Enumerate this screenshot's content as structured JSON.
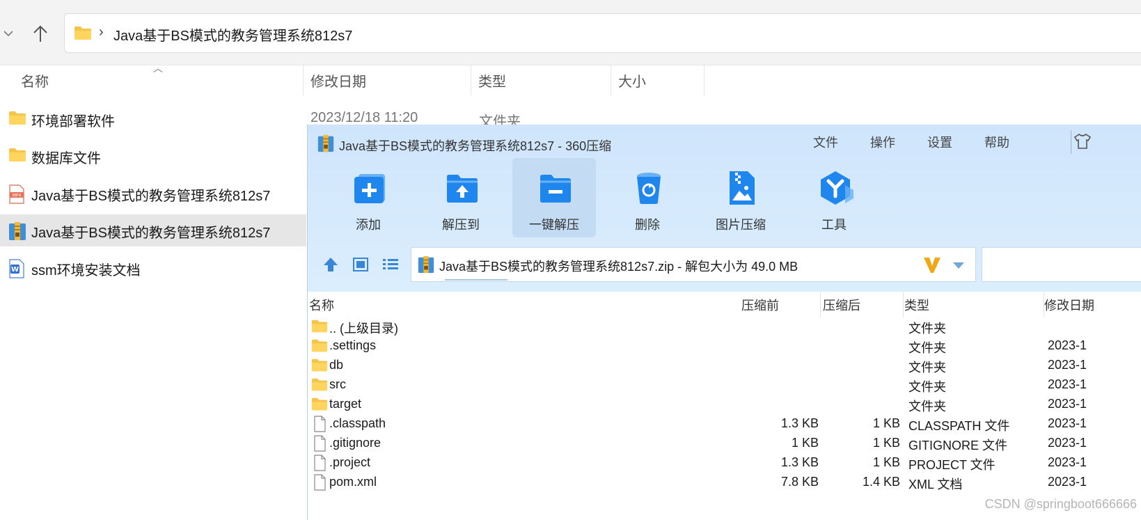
{
  "explorer": {
    "address": {
      "separator": "›",
      "path": "Java基于BS模式的教务管理系统812s7"
    },
    "columns": {
      "name": "名称",
      "date": "修改日期",
      "type": "类型",
      "size": "大小"
    },
    "rows": [
      {
        "name": "环境部署软件",
        "date": "2023/12/18 11:20",
        "type": "文件夹",
        "icon": "folder-icon"
      },
      {
        "name": "数据库文件",
        "icon": "folder-icon"
      },
      {
        "name": "Java基于BS模式的教务管理系统812s7",
        "icon": "mp4-file-icon"
      },
      {
        "name": "Java基于BS模式的教务管理系统812s7",
        "icon": "zip-archive-icon",
        "selected": true
      },
      {
        "name": "ssm环境安装文档",
        "icon": "word-doc-icon"
      }
    ]
  },
  "zip": {
    "title": "Java基于BS模式的教务管理系统812s7 - 360压缩",
    "menu": [
      "文件",
      "操作",
      "设置",
      "帮助"
    ],
    "toolbar": [
      {
        "label": "添加",
        "icon": "add-icon"
      },
      {
        "label": "解压到",
        "icon": "extract-to-icon"
      },
      {
        "label": "一键解压",
        "icon": "one-click-extract-icon",
        "active": true
      },
      {
        "label": "删除",
        "icon": "delete-icon"
      },
      {
        "label": "图片压缩",
        "icon": "image-compress-icon"
      },
      {
        "label": "工具",
        "icon": "tools-icon"
      }
    ],
    "path_text": "Java基于BS模式的教务管理系统812s7.zip - 解包大小为 49.0 MB",
    "list_columns": {
      "name": "名称",
      "before": "压缩前",
      "after": "压缩后",
      "type": "类型",
      "date": "修改日期"
    },
    "files": [
      {
        "name": ".. (上级目录)",
        "before": "",
        "after": "",
        "type": "文件夹",
        "date": "",
        "icon": "folder"
      },
      {
        "name": ".settings",
        "before": "",
        "after": "",
        "type": "文件夹",
        "date": "2023-1",
        "icon": "folder"
      },
      {
        "name": "db",
        "before": "",
        "after": "",
        "type": "文件夹",
        "date": "2023-1",
        "icon": "folder"
      },
      {
        "name": "src",
        "before": "",
        "after": "",
        "type": "文件夹",
        "date": "2023-1",
        "icon": "folder"
      },
      {
        "name": "target",
        "before": "",
        "after": "",
        "type": "文件夹",
        "date": "2023-1",
        "icon": "folder"
      },
      {
        "name": ".classpath",
        "before": "1.3 KB",
        "after": "1 KB",
        "type": "CLASSPATH 文件",
        "date": "2023-1",
        "icon": "file"
      },
      {
        "name": ".gitignore",
        "before": "1 KB",
        "after": "1 KB",
        "type": "GITIGNORE 文件",
        "date": "2023-1",
        "icon": "file"
      },
      {
        "name": ".project",
        "before": "1.3 KB",
        "after": "1 KB",
        "type": "PROJECT 文件",
        "date": "2023-1",
        "icon": "file"
      },
      {
        "name": "pom.xml",
        "before": "7.8 KB",
        "after": "1.4 KB",
        "type": "XML 文档",
        "date": "2023-1",
        "icon": "file"
      }
    ]
  },
  "watermark": "CSDN @springboot666666"
}
